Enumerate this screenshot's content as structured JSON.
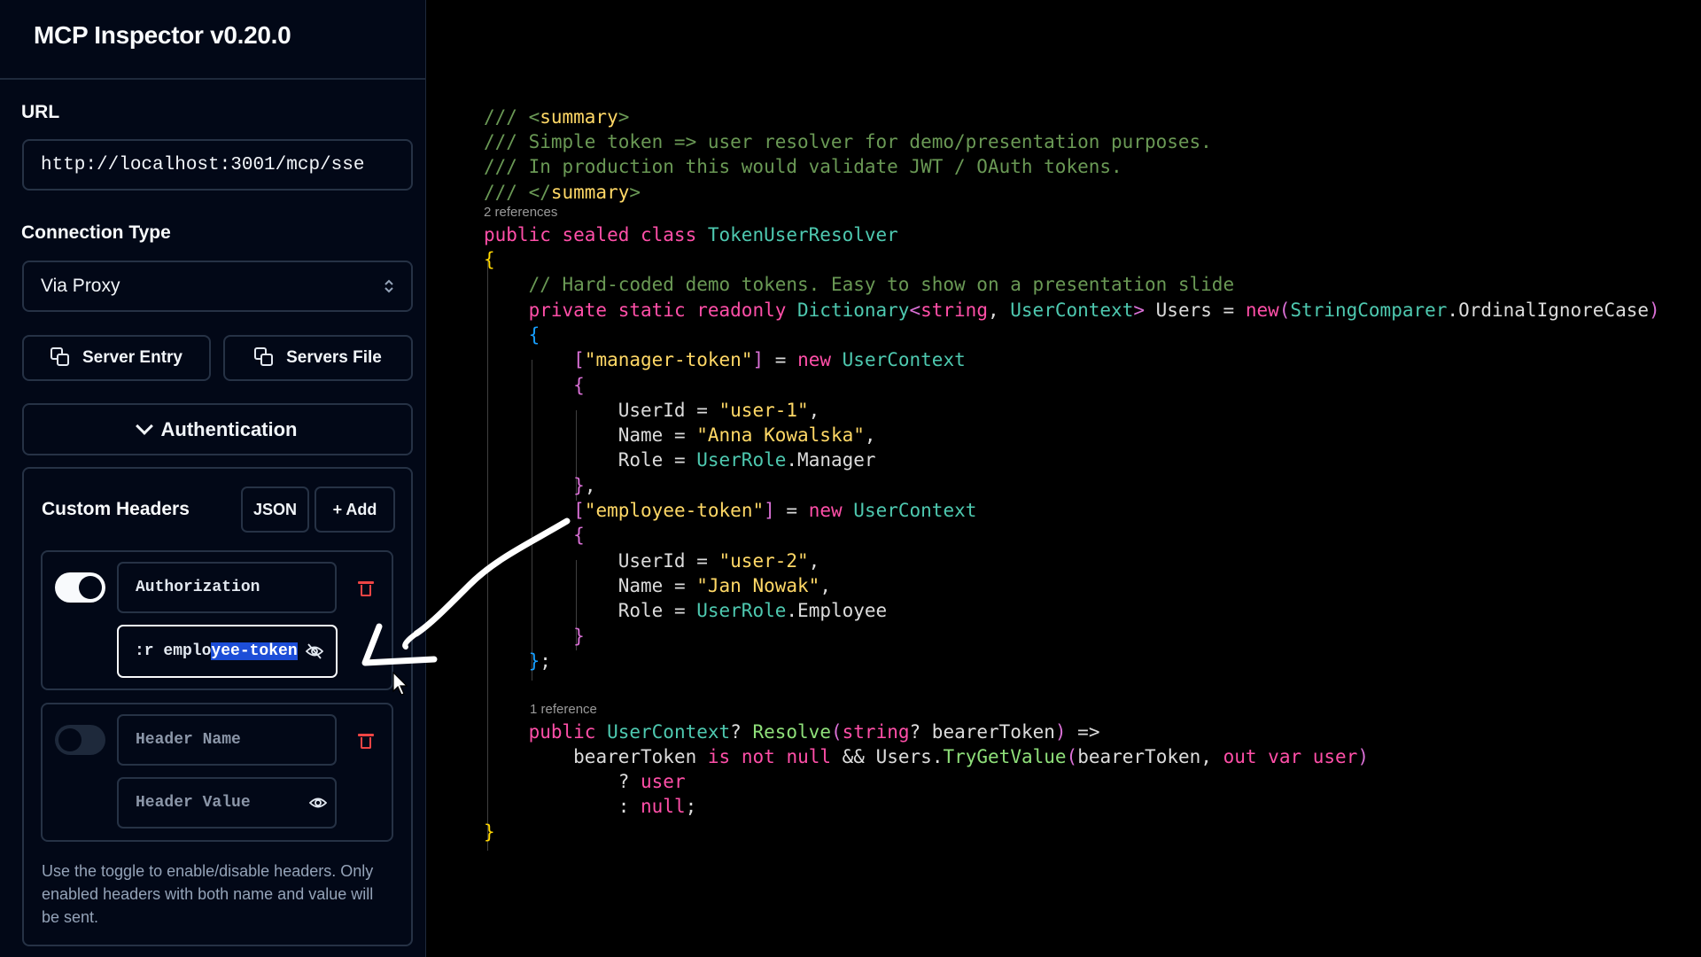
{
  "app": {
    "title": "MCP Inspector v0.20.0"
  },
  "sidebar": {
    "url_label": "URL",
    "url_value": "http://localhost:3001/mcp/sse",
    "connection_type_label": "Connection Type",
    "connection_type_value": "Via Proxy",
    "server_entry_button": "Server Entry",
    "servers_file_button": "Servers File",
    "authentication_button": "Authentication",
    "custom_headers": {
      "title": "Custom Headers",
      "json_button": "JSON",
      "add_button": "+ Add",
      "headers": [
        {
          "enabled": true,
          "name": "Authorization",
          "value_prefix": ":r emplo",
          "value_selected": "yee-token"
        },
        {
          "enabled": false,
          "name_placeholder": "Header Name",
          "value_placeholder": "Header Value"
        }
      ],
      "help_text": "Use the toggle to enable/disable headers. Only enabled headers with both name and value will be sent."
    }
  },
  "code": {
    "doc": {
      "l1_a": "/// <",
      "l1_tag": "summary",
      "l1_b": ">",
      "l2": "/// Simple token => user resolver for demo/presentation purposes.",
      "l3": "/// In production this would validate JWT / OAuth tokens.",
      "l4_a": "/// </",
      "l4_tag": "summary",
      "l4_b": ">"
    },
    "codelens_class": "2 references",
    "codelens_method": "1 reference",
    "class_kw": "public sealed class ",
    "class_name": "TokenUserResolver",
    "comment": "// Hard-coded demo tokens. Easy to show on a presentation slide",
    "field_kw": "private static readonly ",
    "dict_type": "Dictionary",
    "string_kw": "string",
    "usercontext": "UserContext",
    "users": "Users",
    "new_kw": "new",
    "comparer": "StringComparer",
    "ordinal": "OrdinalIgnoreCase",
    "manager_key": "\"manager-token\"",
    "employee_key": "\"employee-token\"",
    "userid": "UserId",
    "name": "Name",
    "role": "Role",
    "user1": "\"user-1\"",
    "user2": "\"user-2\"",
    "anna": "\"Anna Kowalska\"",
    "jan": "\"Jan Nowak\"",
    "userrole": "UserRole",
    "manager": "Manager",
    "employee": "Employee",
    "public_kw": "public",
    "resolve": "Resolve",
    "bearer": "bearerToken",
    "is_kw": "is",
    "not_kw": "not",
    "null_kw": "null",
    "trygetvalue": "TryGetValue",
    "out_kw": "out",
    "var_kw": "var",
    "user_var": "user"
  }
}
